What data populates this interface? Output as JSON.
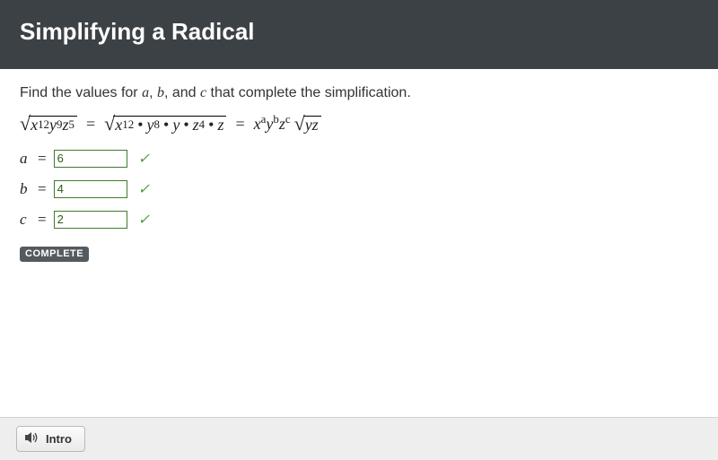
{
  "header": {
    "title": "Simplifying a Radical"
  },
  "prompt": {
    "before_a": "Find the values for ",
    "a": "a",
    "between_ab": ", ",
    "b": "b",
    "between_bc": ", and ",
    "c": "c",
    "after": " that complete the simplification."
  },
  "equation": {
    "lhs": {
      "x_exp": "12",
      "y_exp": "9",
      "z_exp": "5"
    },
    "mid": {
      "x_exp": "12",
      "y_exp": "8",
      "z_exp": "4"
    },
    "rhs": {
      "a": "a",
      "b": "b",
      "c": "c",
      "rad": "yz"
    }
  },
  "answers": {
    "a": {
      "label": "a",
      "value": "6"
    },
    "b": {
      "label": "b",
      "value": "4"
    },
    "c": {
      "label": "c",
      "value": "2"
    }
  },
  "status": {
    "complete_label": "COMPLETE"
  },
  "footer": {
    "intro_label": "Intro"
  }
}
